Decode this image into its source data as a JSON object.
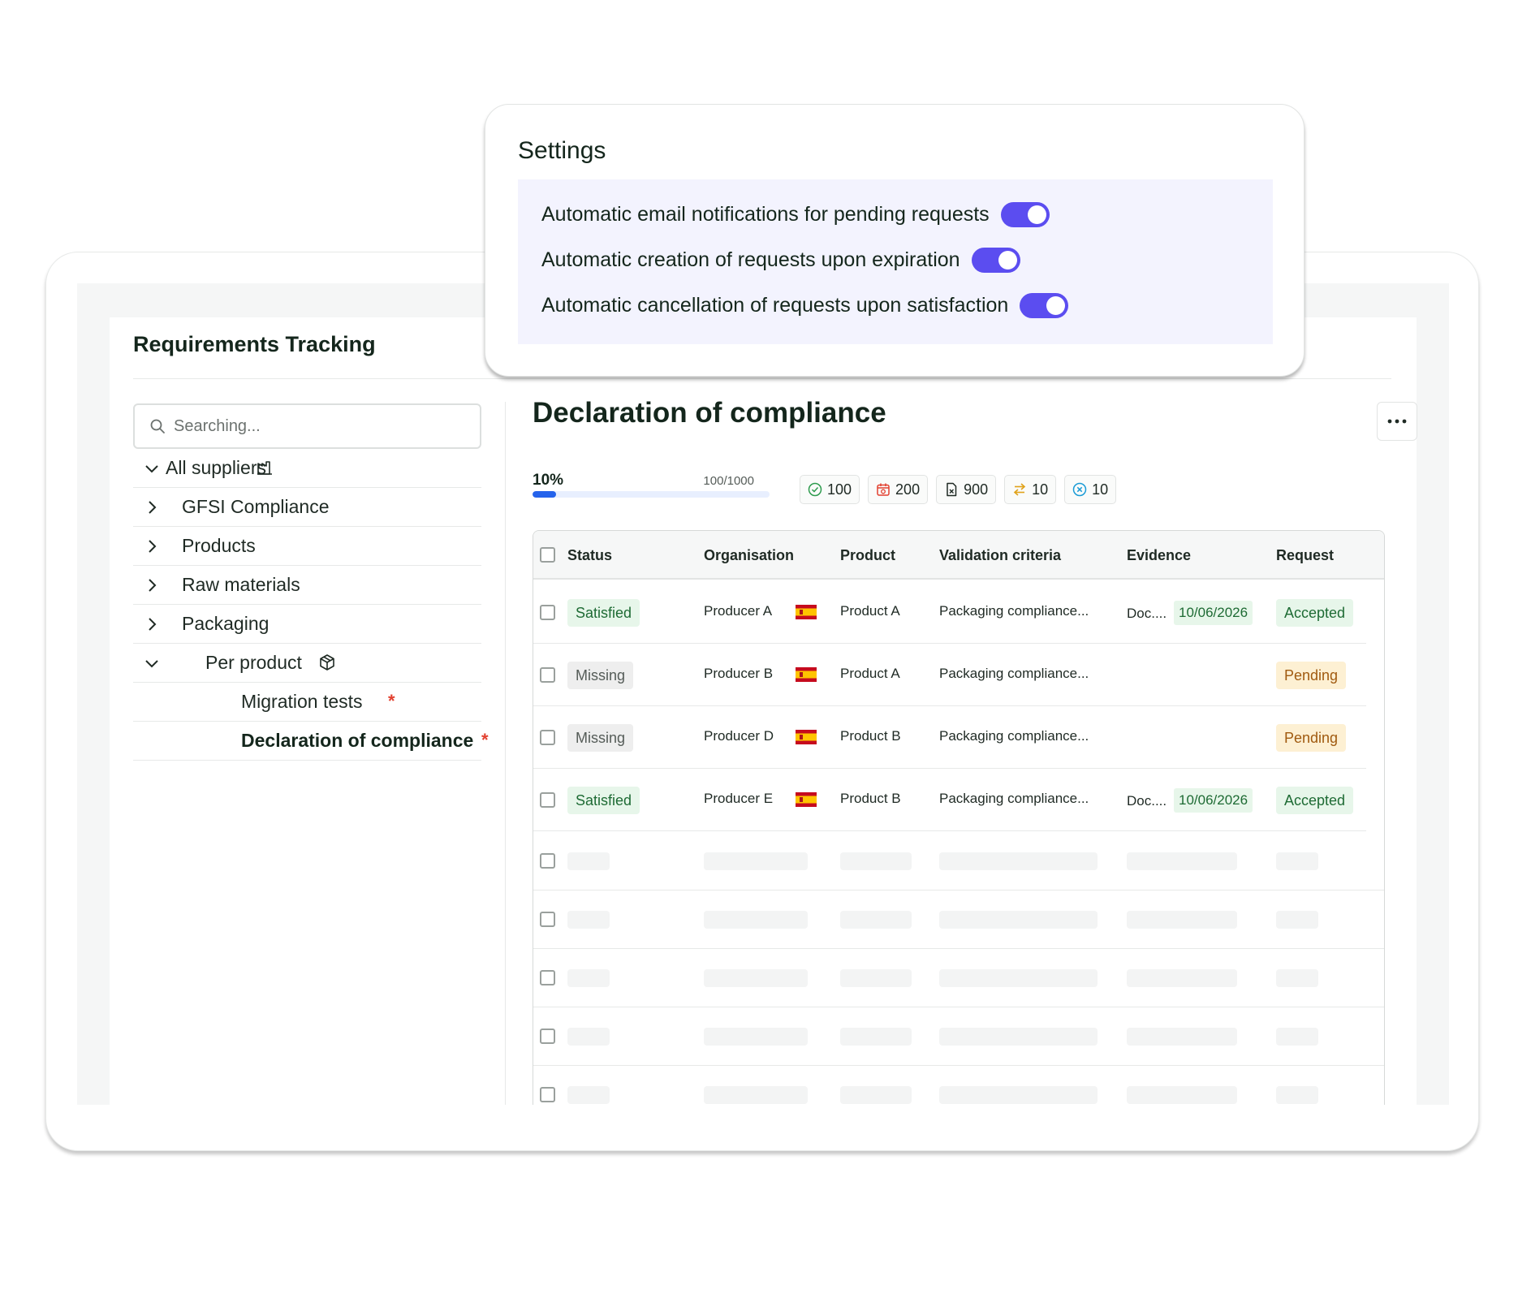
{
  "settings": {
    "title": "Settings",
    "options": [
      {
        "label": "Automatic email notifications for pending requests",
        "enabled": true
      },
      {
        "label": "Automatic creation of requests upon expiration",
        "enabled": true
      },
      {
        "label": "Automatic cancellation of requests upon satisfaction",
        "enabled": true
      }
    ]
  },
  "app": {
    "title": "Requirements Tracking"
  },
  "sidebar": {
    "search_placeholder": "Searching...",
    "tree": [
      {
        "label": "All suppliers",
        "icon": "factory-icon",
        "expanded": true
      },
      {
        "label": "GFSI Compliance"
      },
      {
        "label": "Products"
      },
      {
        "label": "Raw materials"
      },
      {
        "label": "Packaging"
      },
      {
        "label": "Per product",
        "icon": "package-icon",
        "expanded": true
      },
      {
        "label": "Migration tests",
        "required_mark": "*"
      },
      {
        "label": "Declaration of compliance",
        "required_mark": "*",
        "active": true
      }
    ]
  },
  "main": {
    "title": "Declaration of compliance",
    "progress": {
      "percent_label": "10%",
      "count_label": "100/1000",
      "fraction": 0.1
    },
    "stats": [
      {
        "icon": "check-circle-icon",
        "value": "100",
        "color": "#2e9b4e"
      },
      {
        "icon": "calendar-alert-icon",
        "value": "200",
        "color": "#e2402f"
      },
      {
        "icon": "file-x-icon",
        "value": "900",
        "color": "#1f2a24"
      },
      {
        "icon": "swap-arrows-icon",
        "value": "10",
        "color": "#e0a21a"
      },
      {
        "icon": "x-circle-icon",
        "value": "10",
        "color": "#1a9bd6"
      }
    ],
    "table": {
      "columns": [
        "Status",
        "Organisation",
        "Product",
        "Validation criteria",
        "Evidence",
        "Request"
      ],
      "rows": [
        {
          "status": "Satisfied",
          "organisation": "Producer A",
          "flag": "spain-flag",
          "product": "Product A",
          "criteria": "Packaging compliance...",
          "evidence": "Doc....",
          "evidence_date": "10/06/2026",
          "request": "Accepted"
        },
        {
          "status": "Missing",
          "organisation": "Producer B",
          "flag": "spain-flag",
          "product": "Product A",
          "criteria": "Packaging compliance...",
          "evidence": "",
          "evidence_date": "",
          "request": "Pending"
        },
        {
          "status": "Missing",
          "organisation": "Producer D",
          "flag": "spain-flag",
          "product": "Product B",
          "criteria": "Packaging compliance...",
          "evidence": "",
          "evidence_date": "",
          "request": "Pending"
        },
        {
          "status": "Satisfied",
          "organisation": "Producer E",
          "flag": "spain-flag",
          "product": "Product B",
          "criteria": "Packaging compliance...",
          "evidence": "Doc....",
          "evidence_date": "10/06/2026",
          "request": "Accepted"
        }
      ]
    }
  }
}
